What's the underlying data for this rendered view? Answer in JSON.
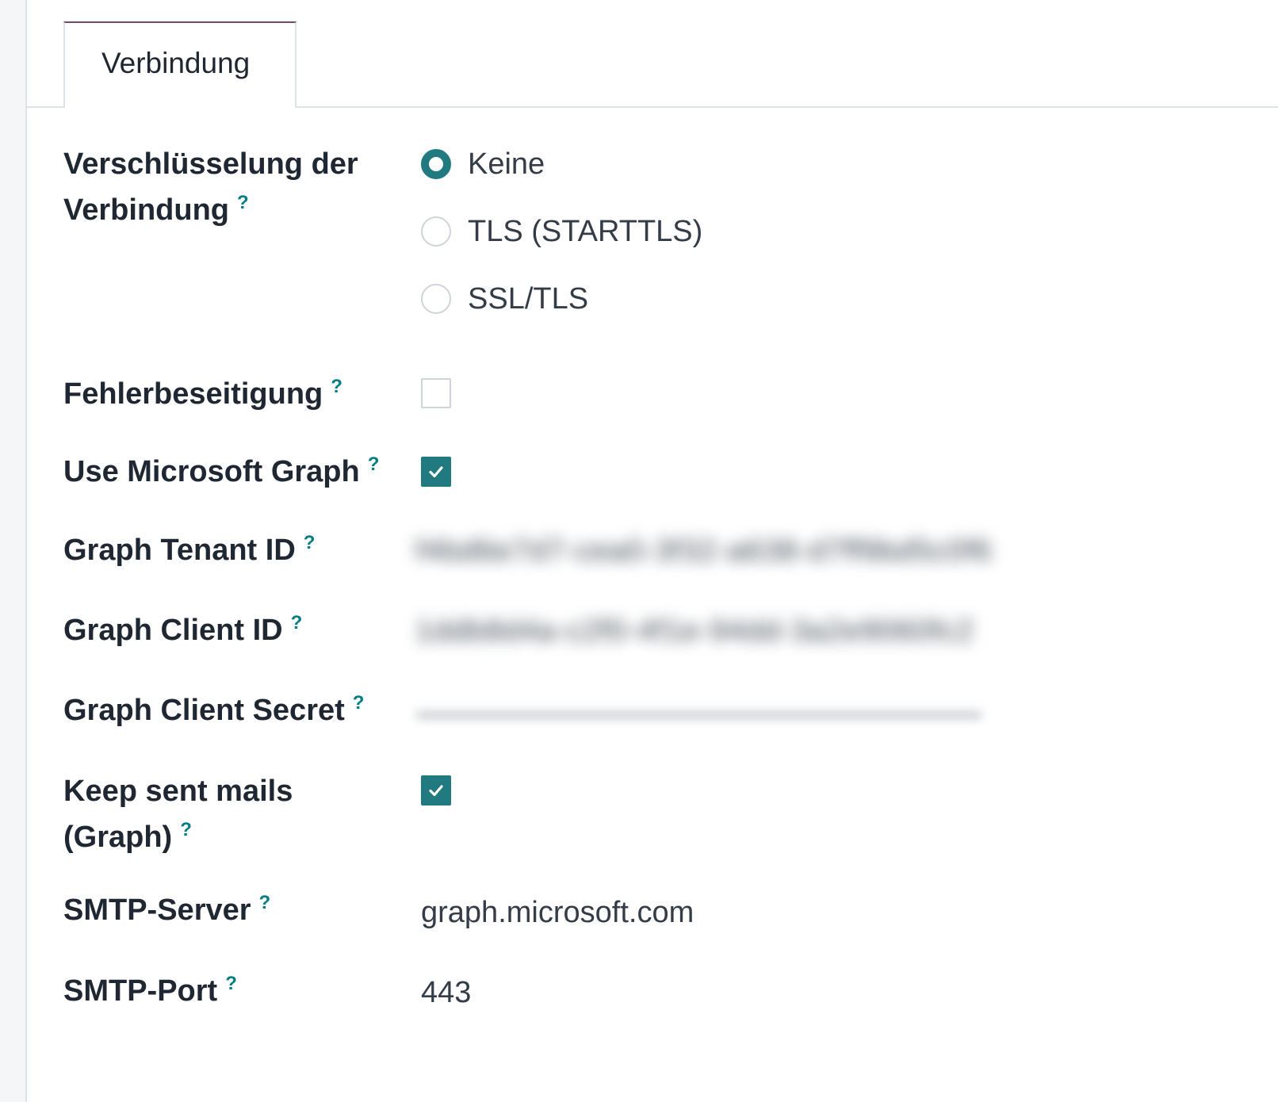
{
  "tabs": [
    {
      "label": "Verbindung",
      "active": true
    }
  ],
  "help_glyph": "?",
  "fields": {
    "encryption": {
      "label_line1": "Verschlüsselung der",
      "label_line2": "Verbindung",
      "options": [
        {
          "label": "Keine",
          "checked": true
        },
        {
          "label": "TLS (STARTTLS)",
          "checked": false
        },
        {
          "label": "SSL/TLS",
          "checked": false
        }
      ]
    },
    "debugging": {
      "label": "Fehlerbeseitigung",
      "checked": false
    },
    "use_graph": {
      "label": "Use Microsoft Graph",
      "checked": true
    },
    "tenant_id": {
      "label": "Graph Tenant ID",
      "value": "f4bd6e7d7-cea0-3f32-a638-d7ff9bd5c0f6"
    },
    "client_id": {
      "label": "Graph Client ID",
      "value": "1ddb8d4a-c2f0-4f1e-94dd-3a2e9060fc2"
    },
    "client_secret": {
      "label": "Graph Client Secret"
    },
    "keep_sent": {
      "label_line1": "Keep sent mails",
      "label_line2": "(Graph)",
      "checked": true
    },
    "smtp_server": {
      "label": "SMTP-Server",
      "value": "graph.microsoft.com"
    },
    "smtp_port": {
      "label": "SMTP-Port",
      "value": "443"
    }
  },
  "colors": {
    "accent": "#217a80",
    "help": "#017e84",
    "tab_top": "#714b67"
  }
}
